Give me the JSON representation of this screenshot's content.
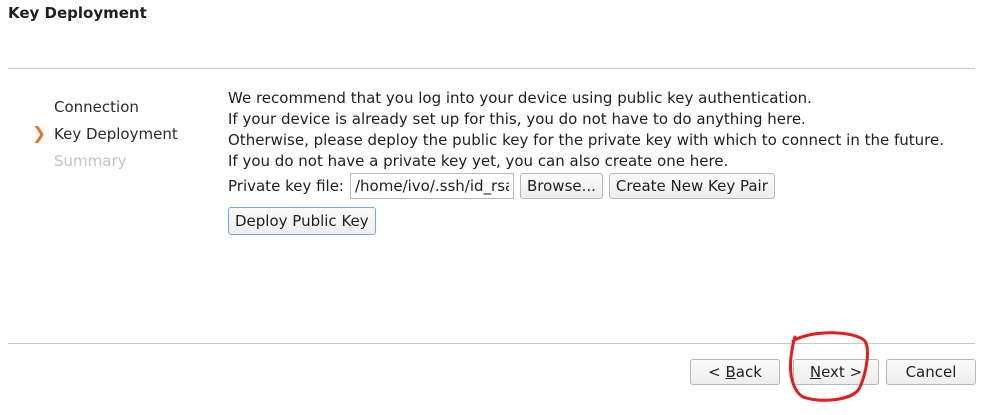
{
  "page": {
    "title": "Key Deployment"
  },
  "steps": [
    {
      "label": "Connection"
    },
    {
      "label": "Key Deployment"
    },
    {
      "label": "Summary"
    }
  ],
  "description": {
    "lines": [
      "We recommend that you log into your device using public key authentication.",
      "If your device is already set up for this, you do not have to do anything here.",
      "Otherwise, please deploy the public key for the private key with which to connect in the future.",
      "If you do not have a private key yet, you can also create one here."
    ]
  },
  "keyfile": {
    "label": "Private key file:",
    "value": "/home/ivo/.ssh/id_rsa"
  },
  "buttons": {
    "browse": "Browse...",
    "create": "Create New Key Pair",
    "deploy": "Deploy Public Key",
    "back_prefix": "< ",
    "back_mnemonic": "B",
    "back_rest": "ack",
    "next_mnemonic": "N",
    "next_rest": "ext >",
    "cancel": "Cancel"
  },
  "colors": {
    "accent_arrow": "#e07a2e",
    "annotation_red": "#e31d1d"
  },
  "icons": {
    "current_step": "chevron-right-icon"
  }
}
